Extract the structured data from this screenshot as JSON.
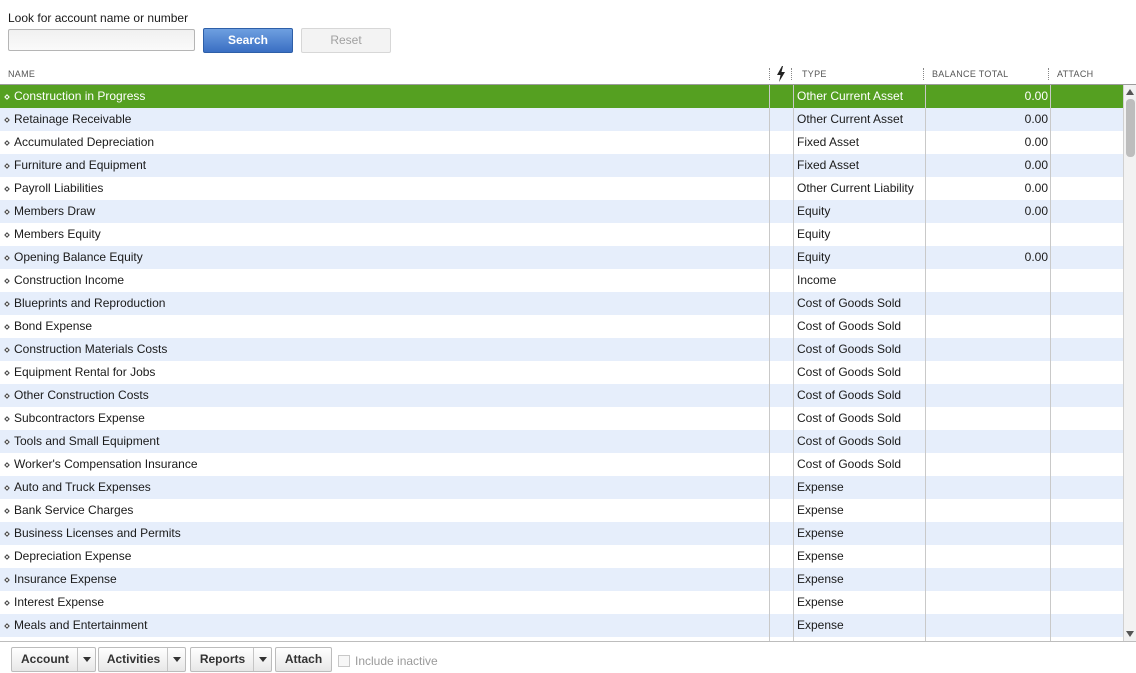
{
  "search": {
    "label": "Look for account name or number",
    "value": "",
    "search_button": "Search",
    "reset_button": "Reset"
  },
  "columns": {
    "name": "NAME",
    "type": "TYPE",
    "balance": "BALANCE TOTAL",
    "attach": "ATTACH"
  },
  "accounts": [
    {
      "name": "Construction in Progress",
      "type": "Other Current Asset",
      "balance": "0.00",
      "selected": true
    },
    {
      "name": "Retainage Receivable",
      "type": "Other Current Asset",
      "balance": "0.00"
    },
    {
      "name": "Accumulated Depreciation",
      "type": "Fixed Asset",
      "balance": "0.00"
    },
    {
      "name": "Furniture and Equipment",
      "type": "Fixed Asset",
      "balance": "0.00"
    },
    {
      "name": "Payroll Liabilities",
      "type": "Other Current Liability",
      "balance": "0.00"
    },
    {
      "name": "Members Draw",
      "type": "Equity",
      "balance": "0.00"
    },
    {
      "name": "Members Equity",
      "type": "Equity",
      "balance": ""
    },
    {
      "name": "Opening Balance Equity",
      "type": "Equity",
      "balance": "0.00"
    },
    {
      "name": "Construction Income",
      "type": "Income",
      "balance": ""
    },
    {
      "name": "Blueprints and Reproduction",
      "type": "Cost of Goods Sold",
      "balance": ""
    },
    {
      "name": "Bond Expense",
      "type": "Cost of Goods Sold",
      "balance": ""
    },
    {
      "name": "Construction Materials Costs",
      "type": "Cost of Goods Sold",
      "balance": ""
    },
    {
      "name": "Equipment Rental for Jobs",
      "type": "Cost of Goods Sold",
      "balance": ""
    },
    {
      "name": "Other Construction Costs",
      "type": "Cost of Goods Sold",
      "balance": ""
    },
    {
      "name": "Subcontractors Expense",
      "type": "Cost of Goods Sold",
      "balance": ""
    },
    {
      "name": "Tools and Small Equipment",
      "type": "Cost of Goods Sold",
      "balance": ""
    },
    {
      "name": "Worker's Compensation Insurance",
      "type": "Cost of Goods Sold",
      "balance": ""
    },
    {
      "name": "Auto and Truck Expenses",
      "type": "Expense",
      "balance": ""
    },
    {
      "name": "Bank Service Charges",
      "type": "Expense",
      "balance": ""
    },
    {
      "name": "Business Licenses and Permits",
      "type": "Expense",
      "balance": ""
    },
    {
      "name": "Depreciation Expense",
      "type": "Expense",
      "balance": ""
    },
    {
      "name": "Insurance Expense",
      "type": "Expense",
      "balance": ""
    },
    {
      "name": "Interest Expense",
      "type": "Expense",
      "balance": ""
    },
    {
      "name": "Meals and Entertainment",
      "type": "Expense",
      "balance": ""
    }
  ],
  "toolbar": {
    "account": "Account",
    "activities": "Activities",
    "reports": "Reports",
    "attach": "Attach",
    "include_inactive": "Include inactive"
  },
  "colors": {
    "selected_row": "#55a021",
    "alt_row": "#e6eefb",
    "search_button": "#3a6fc3"
  },
  "icons": {
    "header_flag": "lightning-bolt-icon",
    "row_marker": "diamond-bullet-icon"
  }
}
